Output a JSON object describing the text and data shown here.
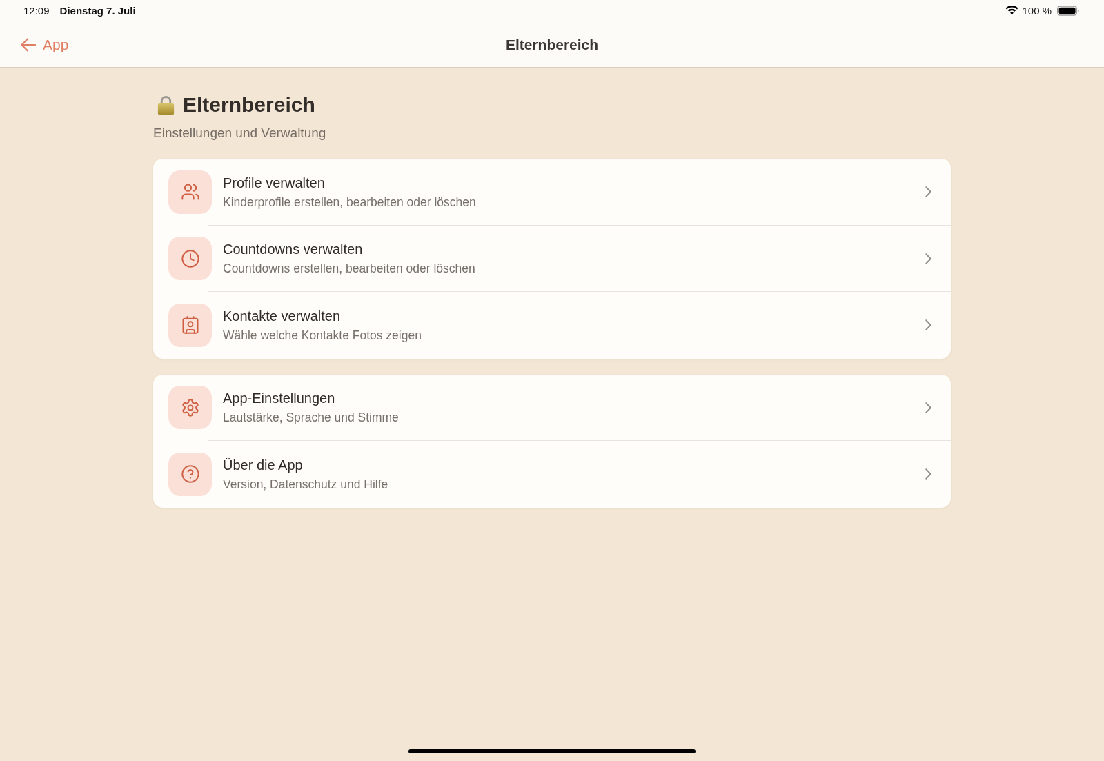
{
  "status_bar": {
    "time": "12:09",
    "date": "Dienstag 7. Juli",
    "battery": "100 %"
  },
  "nav_bar": {
    "back_label": "App",
    "title": "Elternbereich"
  },
  "header": {
    "title": "Elternbereich",
    "subtitle": "Einstellungen und Verwaltung"
  },
  "groups": [
    {
      "items": [
        {
          "kind": "profiles",
          "title": "Profile verwalten",
          "subtitle": "Kinderprofile erstellen, bearbeiten oder löschen"
        },
        {
          "kind": "countdowns",
          "title": "Countdowns verwalten",
          "subtitle": "Countdowns erstellen, bearbeiten oder löschen"
        },
        {
          "kind": "contacts",
          "title": "Kontakte verwalten",
          "subtitle": "Wähle welche Kontakte Fotos zeigen"
        }
      ]
    },
    {
      "items": [
        {
          "kind": "settings",
          "title": "App-Einstellungen",
          "subtitle": "Lautstärke, Sprache und Stimme"
        },
        {
          "kind": "about",
          "title": "Über die App",
          "subtitle": "Version, Datenschutz und Hilfe"
        }
      ]
    }
  ]
}
